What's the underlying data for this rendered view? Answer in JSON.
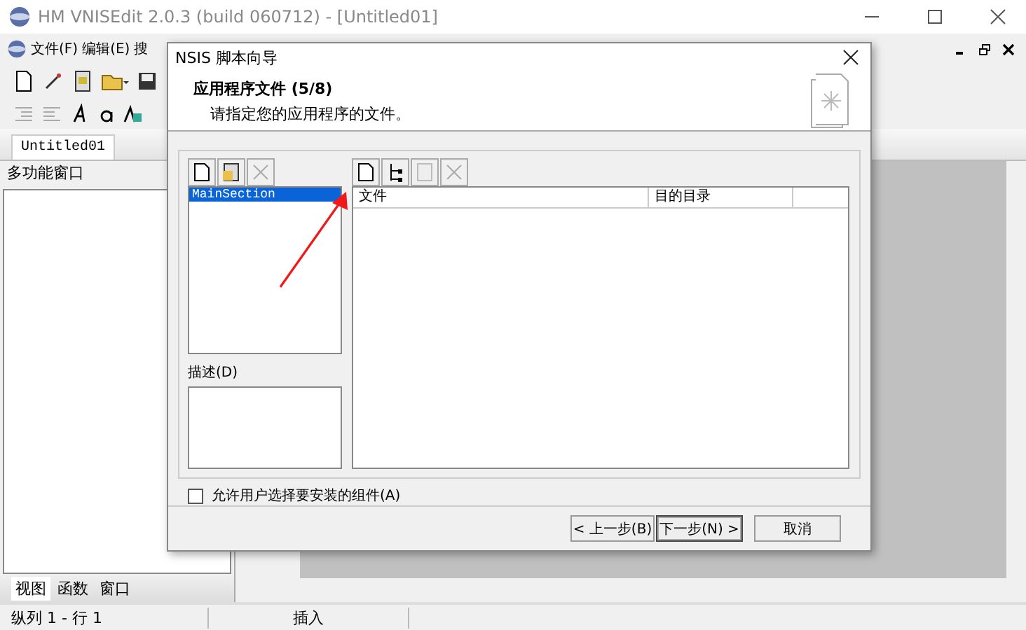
{
  "window": {
    "title": "HM VNISEdit 2.0.3 (build 060712) - [Untitled01]"
  },
  "menu": [
    "文件(F)",
    "编辑(E)",
    "搜"
  ],
  "editor_tabs": [
    {
      "label": "Untitled01",
      "selected": true
    }
  ],
  "side_panel": {
    "title": "多功能窗口",
    "tabs": [
      {
        "label": "视图",
        "selected": true
      },
      {
        "label": "函数",
        "selected": false
      },
      {
        "label": "窗口",
        "selected": false
      }
    ]
  },
  "status_bar": [
    "纵列 1 - 行 1",
    "插入"
  ],
  "dialog": {
    "title": "NSIS 脚本向导",
    "heading": "应用程序文件 (5/8)",
    "subheading": "请指定您的应用程序的文件。",
    "sections": [
      {
        "label": "MainSection",
        "selected": true
      }
    ],
    "file_columns": [
      "文件",
      "目的目录"
    ],
    "description_label": "描述(D)",
    "allow_select": {
      "label": "允许用户选择要安装的组件(A)",
      "checked": false
    },
    "buttons": [
      {
        "label": "< 上一步(B)",
        "kind": "normal"
      },
      {
        "label": "下一步(N) >",
        "kind": "default"
      },
      {
        "label": "取消",
        "kind": "normal"
      }
    ]
  }
}
